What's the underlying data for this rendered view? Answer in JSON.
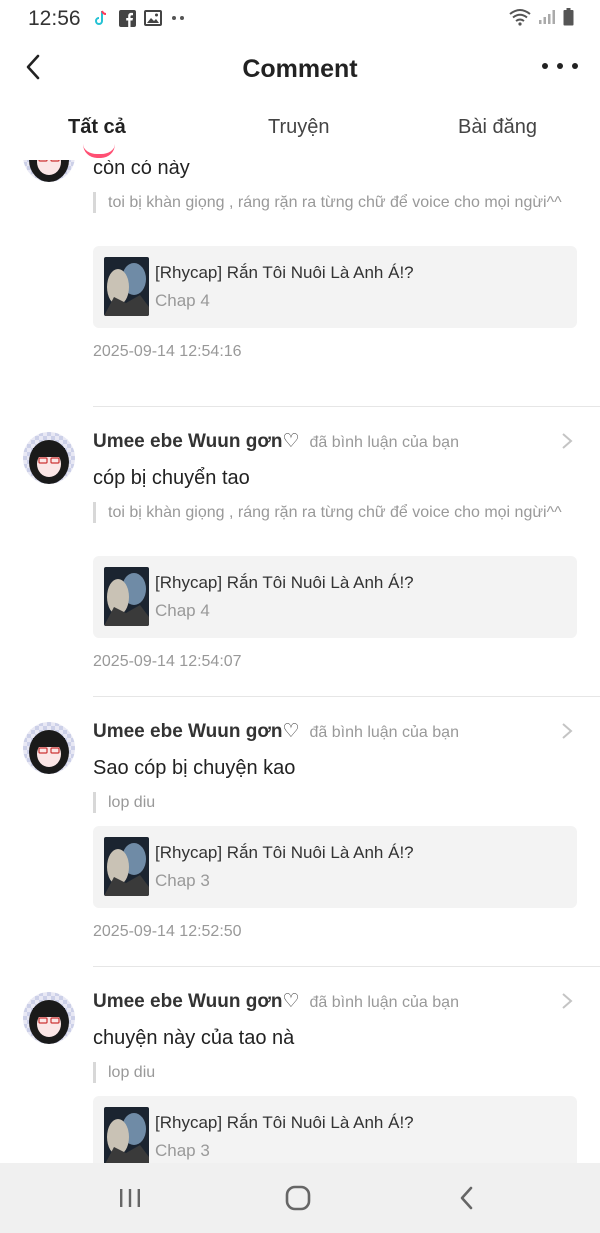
{
  "status_bar": {
    "time": "12:56",
    "left_icons": [
      "tiktok-icon",
      "facebook-icon",
      "gallery-icon",
      "more-dots-icon"
    ],
    "right_icons": [
      "wifi-icon",
      "signal-icon",
      "battery-icon"
    ]
  },
  "header": {
    "title": "Comment",
    "back_icon": "chevron-left-icon",
    "more_icon": "more-horizontal-icon"
  },
  "tabs": [
    {
      "label": "Tất cả",
      "active": true
    },
    {
      "label": "Truyện",
      "active": false
    },
    {
      "label": "Bài đăng",
      "active": false
    }
  ],
  "accent_color": "#ff4f73",
  "comments": [
    {
      "user": "",
      "action": "",
      "text": "còn có này",
      "quote": "toi bị khàn giọng , ráng rặn ra từng chữ để voice cho mọi ngừi^^",
      "work_title": "[Rhycap] Rắn Tôi Nuôi Là Anh Á!?",
      "chapter": "Chap 4",
      "timestamp": "2025-09-14 12:54:16"
    },
    {
      "user": "Umee ebe Wuun gơn♡",
      "action": "đã bình luận của bạn",
      "text": "cóp bị chuyển tao",
      "quote": "toi bị khàn giọng , ráng rặn ra từng chữ để voice cho mọi ngừi^^",
      "work_title": "[Rhycap] Rắn Tôi Nuôi Là Anh Á!?",
      "chapter": "Chap 4",
      "timestamp": "2025-09-14 12:54:07"
    },
    {
      "user": "Umee ebe Wuun gơn♡",
      "action": "đã bình luận của bạn",
      "text": "Sao cóp bị chuyện kao",
      "quote": "lop diu",
      "work_title": "[Rhycap] Rắn Tôi Nuôi Là Anh Á!?",
      "chapter": "Chap 3",
      "timestamp": "2025-09-14 12:52:50"
    },
    {
      "user": "Umee ebe Wuun gơn♡",
      "action": "đã bình luận của bạn",
      "text": "chuyện này của tao nà",
      "quote": "lop diu",
      "work_title": "[Rhycap] Rắn Tôi Nuôi Là Anh Á!?",
      "chapter": "Chap 3",
      "timestamp": ""
    }
  ],
  "nav_bar": {
    "icons": [
      "recent-apps-icon",
      "home-icon",
      "back-icon"
    ]
  }
}
